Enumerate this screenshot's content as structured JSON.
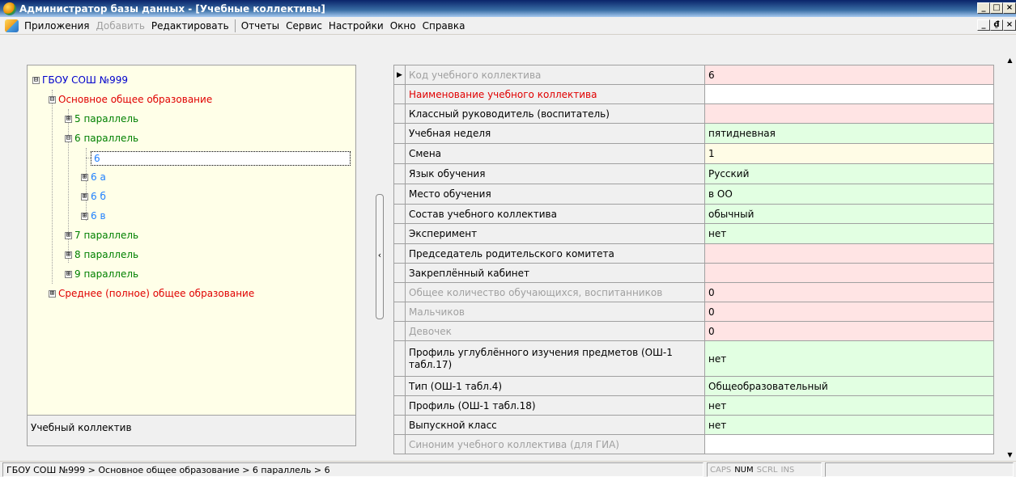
{
  "window": {
    "title": "Администратор базы данных - [Учебные коллективы]",
    "buttons": [
      "_",
      "□",
      "×"
    ]
  },
  "menu": {
    "items": [
      {
        "label": "Приложения",
        "enabled": true
      },
      {
        "label": "Добавить",
        "enabled": false
      },
      {
        "label": "Редактировать",
        "enabled": true
      },
      {
        "label": "Отчеты",
        "enabled": true
      },
      {
        "label": "Сервис",
        "enabled": true
      },
      {
        "label": "Настройки",
        "enabled": true
      },
      {
        "label": "Окно",
        "enabled": true
      },
      {
        "label": "Справка",
        "enabled": true
      }
    ],
    "mdi_buttons": [
      "_",
      "₫",
      "×"
    ]
  },
  "tree": {
    "nodes": [
      {
        "label": "ГБОУ СОШ №999",
        "toggle": "⊟",
        "color": "blue"
      },
      {
        "label": "Основное общее образование",
        "toggle": "⊟",
        "color": "red"
      },
      {
        "label": "5 параллель",
        "toggle": "⊞",
        "color": "green"
      },
      {
        "label": "6 параллель",
        "toggle": "⊟",
        "color": "green"
      },
      {
        "label": "6",
        "toggle": "",
        "color": "lblue",
        "selected": true
      },
      {
        "label": "6 а",
        "toggle": "⊞",
        "color": "lblue"
      },
      {
        "label": "6 б",
        "toggle": "⊞",
        "color": "lblue"
      },
      {
        "label": "6 в",
        "toggle": "⊞",
        "color": "lblue"
      },
      {
        "label": "7 параллель",
        "toggle": "⊞",
        "color": "green"
      },
      {
        "label": "8 параллель",
        "toggle": "⊞",
        "color": "green"
      },
      {
        "label": "9 параллель",
        "toggle": "⊞",
        "color": "green"
      },
      {
        "label": "Среднее (полное) общее образование",
        "toggle": "⊞",
        "color": "red"
      }
    ],
    "footer_label": "Учебный коллектив"
  },
  "splitter": {
    "arrow": "‹"
  },
  "grid": {
    "current_row_indicator": "▶",
    "rows": [
      {
        "name": "Код учебного коллектива",
        "value": "6",
        "name_style": "gray",
        "bg": "pink"
      },
      {
        "name": "Наименование учебного коллектива",
        "value": "",
        "name_style": "red",
        "bg": "white"
      },
      {
        "name": "Классный руководитель (воспитатель)",
        "value": "",
        "name_style": "normal",
        "bg": "pink"
      },
      {
        "name": "Учебная неделя",
        "value": "пятидневная",
        "name_style": "normal",
        "bg": "green"
      },
      {
        "name": "Смена",
        "value": "1",
        "name_style": "normal",
        "bg": "yellow"
      },
      {
        "name": "Язык обучения",
        "value": "Русский",
        "name_style": "normal",
        "bg": "green"
      },
      {
        "name": "Место обучения",
        "value": "в ОО",
        "name_style": "normal",
        "bg": "green"
      },
      {
        "name": "Состав учебного коллектива",
        "value": "обычный",
        "name_style": "normal",
        "bg": "green"
      },
      {
        "name": "Эксперимент",
        "value": "нет",
        "name_style": "normal",
        "bg": "green"
      },
      {
        "name": "Председатель родительского комитета",
        "value": "",
        "name_style": "normal",
        "bg": "pink"
      },
      {
        "name": "Закреплённый кабинет",
        "value": "",
        "name_style": "normal",
        "bg": "pink"
      },
      {
        "name": "Общее количество обучающихся, воспитанников",
        "value": "0",
        "name_style": "gray",
        "bg": "pink"
      },
      {
        "name": "Мальчиков",
        "value": "0",
        "name_style": "gray",
        "bg": "pink"
      },
      {
        "name": "Девочек",
        "value": "0",
        "name_style": "gray",
        "bg": "pink"
      },
      {
        "name": "Профиль углублённого изучения предметов (ОШ-1 табл.17)",
        "value": "нет",
        "name_style": "normal",
        "bg": "green",
        "tall": true
      },
      {
        "name": "Тип (ОШ-1 табл.4)",
        "value": "Общеобразовательный",
        "name_style": "normal",
        "bg": "green"
      },
      {
        "name": "Профиль (ОШ-1 табл.18)",
        "value": "нет",
        "name_style": "normal",
        "bg": "green"
      },
      {
        "name": "Выпускной класс",
        "value": "нет",
        "name_style": "normal",
        "bg": "green"
      },
      {
        "name": "Синоним учебного коллектива (для ГИА)",
        "value": "",
        "name_style": "gray",
        "bg": "white"
      }
    ]
  },
  "scrollbar": {
    "up": "▲",
    "down": "▼"
  },
  "status": {
    "path": "ГБОУ СОШ №999 > Основное общее образование > 6 параллель > 6",
    "keys": [
      {
        "label": "CAPS",
        "on": false
      },
      {
        "label": "NUM",
        "on": true
      },
      {
        "label": "SCRL",
        "on": false
      },
      {
        "label": "INS",
        "on": false
      }
    ]
  },
  "colors": {
    "pink": "#ffe4e4",
    "green": "#e2ffe2",
    "yellow": "#fffce6",
    "tree_bg": "#ffffe8",
    "title_start": "#0a246a"
  }
}
